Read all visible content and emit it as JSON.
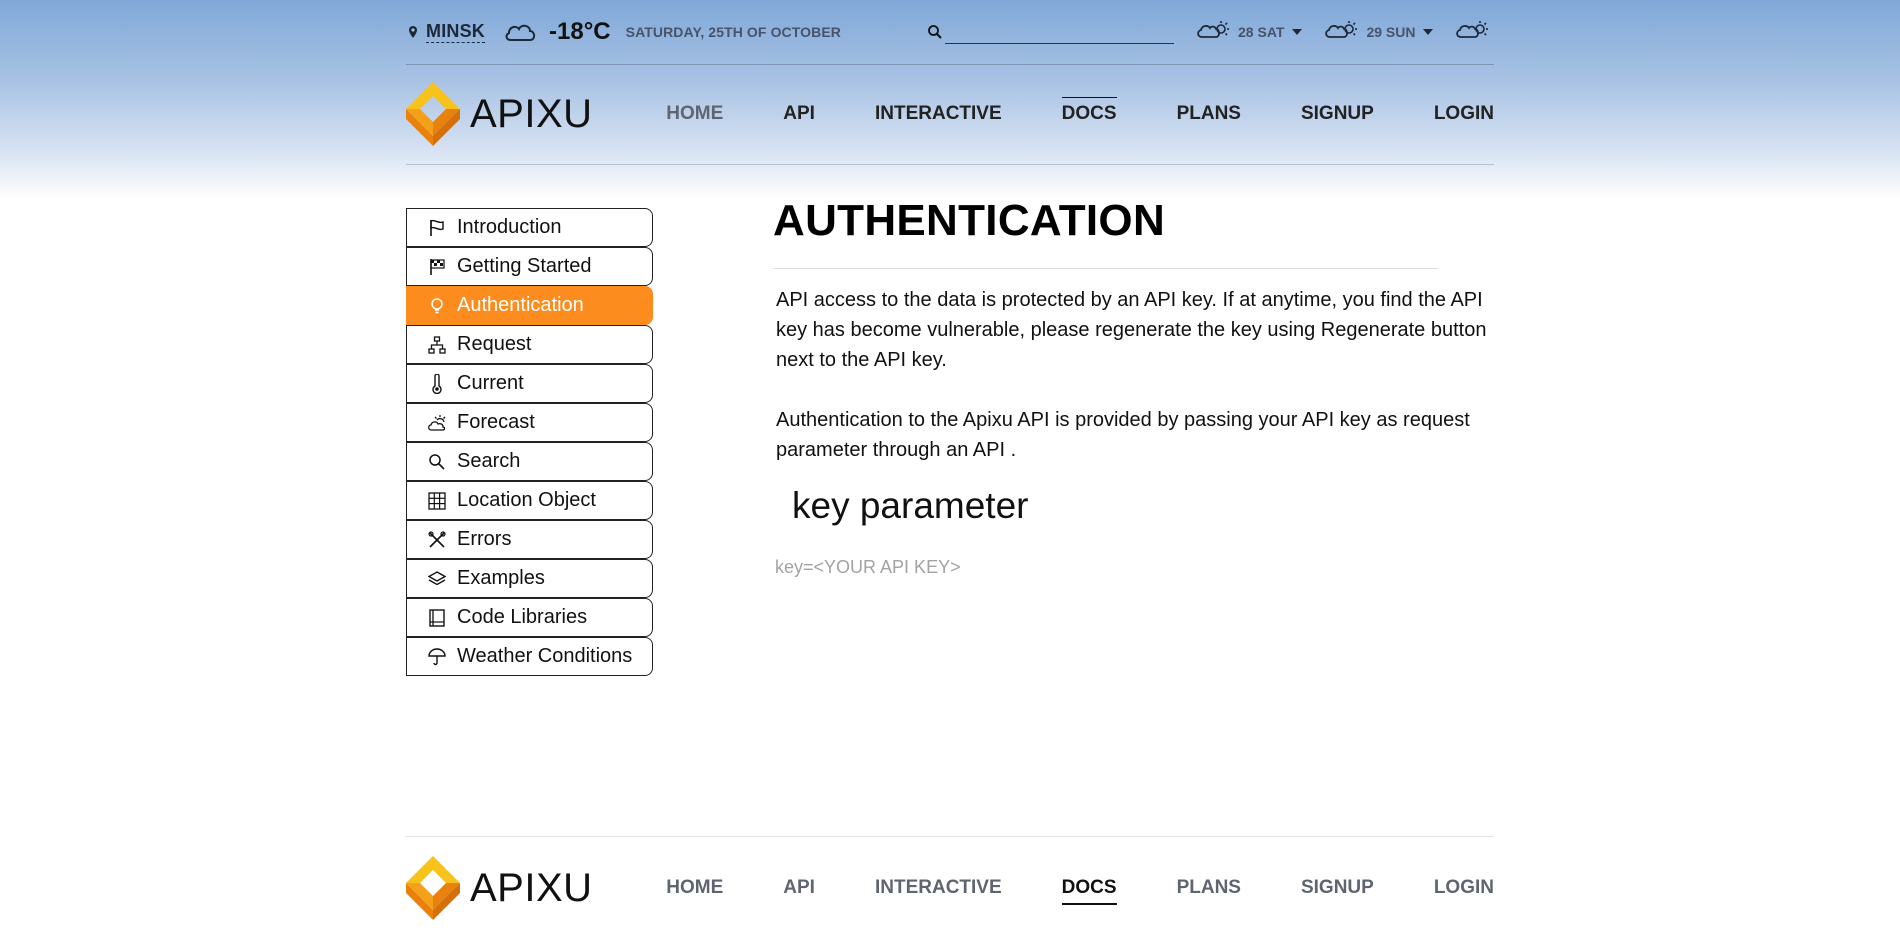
{
  "topbar": {
    "city": "MINSK",
    "temperature": "-18°C",
    "date": "SATURDAY, 25TH OF OCTOBER",
    "search_placeholder": "",
    "forecast": [
      {
        "label": "28 SAT",
        "icon": "partly-sunny-icon"
      },
      {
        "label": "29 SUN",
        "icon": "partly-sunny-icon"
      },
      {
        "label": "",
        "icon": "partly-sunny-icon"
      }
    ]
  },
  "header": {
    "logo_text": "APIXU",
    "nav": [
      {
        "label": "HOME"
      },
      {
        "label": "API"
      },
      {
        "label": "INTERACTIVE"
      },
      {
        "label": "DOCS"
      },
      {
        "label": "PLANS"
      },
      {
        "label": "SIGNUP"
      },
      {
        "label": "LOGIN"
      }
    ],
    "active_nav": "DOCS"
  },
  "sidebar": {
    "items": [
      {
        "label": "Introduction",
        "icon": "flag-icon"
      },
      {
        "label": "Getting Started",
        "icon": "checkered-flag-icon"
      },
      {
        "label": "Authentication",
        "icon": "lightbulb-icon"
      },
      {
        "label": "Request",
        "icon": "sitemap-icon"
      },
      {
        "label": "Current",
        "icon": "thermometer-icon"
      },
      {
        "label": "Forecast",
        "icon": "cloud-sun-icon"
      },
      {
        "label": "Search",
        "icon": "search-icon"
      },
      {
        "label": "Location Object",
        "icon": "grid-icon"
      },
      {
        "label": "Errors",
        "icon": "tools-icon"
      },
      {
        "label": "Examples",
        "icon": "layers-icon"
      },
      {
        "label": "Code Libraries",
        "icon": "book-icon"
      },
      {
        "label": "Weather Conditions",
        "icon": "umbrella-icon"
      }
    ],
    "active": "Authentication"
  },
  "content": {
    "title": "AUTHENTICATION",
    "paragraph1": "API access to the data is protected by an API key. If at anytime, you find the API key has become vulnerable, please regenerate the key using Regenerate button next to the API key.",
    "paragraph2": "Authentication to the Apixu API is provided by passing your API key as request parameter through an API .",
    "subtitle": "key parameter",
    "code": "key=<YOUR API KEY>"
  },
  "footer": {
    "logo_text": "APIXU",
    "nav": [
      {
        "label": "HOME"
      },
      {
        "label": "API"
      },
      {
        "label": "INTERACTIVE"
      },
      {
        "label": "DOCS"
      },
      {
        "label": "PLANS"
      },
      {
        "label": "SIGNUP"
      },
      {
        "label": "LOGIN"
      }
    ]
  },
  "colors": {
    "accent": "#fb8c1d",
    "logo_yellow": "#f7c21c",
    "logo_orange": "#e8820c",
    "top_gradient": "#80a8d8"
  }
}
